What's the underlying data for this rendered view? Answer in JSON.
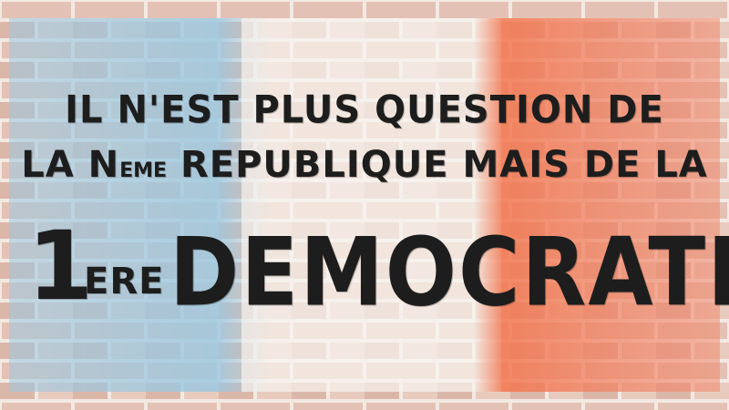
{
  "slogan": {
    "line1": "IL N'EST PLUS QUESTION DE",
    "line2_start": "LA N",
    "line2_superscript": "EME",
    "line2_end": " REPUBLIQUE MAIS DE LA",
    "line3_number": "1",
    "line3_suffix": "ERE",
    "line3_word": "DEMOCRATIE"
  },
  "flag": {
    "blue": "#9cc8e0",
    "white": "#f4f0ec",
    "red": "#f2764f"
  },
  "colors": {
    "brick": "#e4c4b8",
    "mortar": "#f3e9e3",
    "ink": "#1d1d1d"
  }
}
